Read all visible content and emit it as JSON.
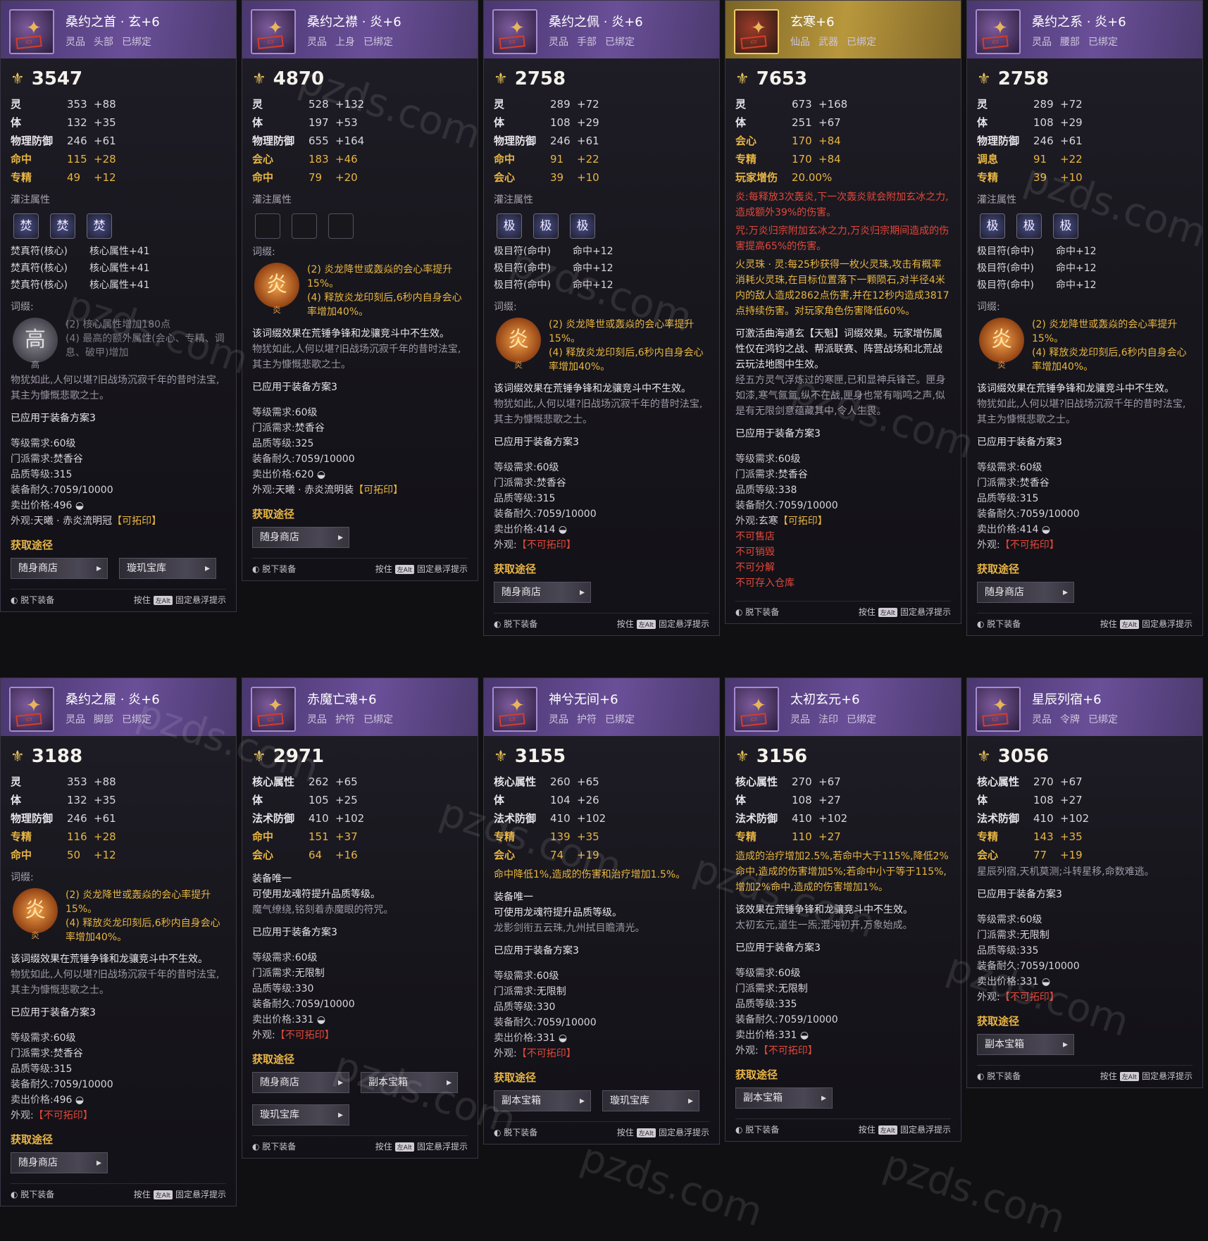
{
  "watermark": "pzds.com",
  "labels": {
    "infuse": "灌注属性",
    "affix": "词缀:",
    "source": "获取途径",
    "unequip": "脱下装备",
    "hold": "按住",
    "key": "左Alt",
    "pin": "固定悬浮提示",
    "levelReq": "等级需求:",
    "sectReq": "门派需求:",
    "quality": "品质等级:",
    "durability": "装备耐久:",
    "price": "卖出价格:",
    "look": "外观:"
  },
  "cards": [
    {
      "name": "桑约之首 · 玄+6",
      "tags": [
        "灵品",
        "头部",
        "已绑定"
      ],
      "power": "3547",
      "stats": [
        {
          "k": "灵",
          "v": "353",
          "b": "+88"
        },
        {
          "k": "体",
          "v": "132",
          "b": "+35"
        },
        {
          "k": "物理防御",
          "v": "246",
          "b": "+61"
        },
        {
          "k": "命中",
          "v": "115",
          "b": "+28",
          "hl": true
        },
        {
          "k": "专精",
          "v": "49",
          "b": "+12",
          "hl": true
        }
      ],
      "gems": [
        "焚",
        "焚",
        "焚"
      ],
      "gemlines": [
        [
          "焚真符(核心)",
          "核心属性+41"
        ],
        [
          "焚真符(核心)",
          "核心属性+41"
        ],
        [
          "焚真符(核心)",
          "核心属性+41"
        ]
      ],
      "badge": "高",
      "badgeGray": true,
      "effects": [
        "(2) 核心属性增加180点",
        "(4) 最高的额外属性(会心、专精、调息、破甲)增加"
      ],
      "effDim": true,
      "noteWhite": "",
      "flavor": "物犹如此,人何以堪?旧战场沉寂千年的昔时法宝,其主为慷慨悲歌之士。",
      "applied": "已应用于装备方案3",
      "level": "60级",
      "sect": "焚香谷",
      "quality": "315",
      "dur": "7059/10000",
      "price": "496",
      "lookA": "天曦 · 赤炎流明冠",
      "lookB": "【可拓印】",
      "lookRed": false,
      "sources": [
        "随身商店",
        "璇玑宝库"
      ]
    },
    {
      "name": "桑约之襟 · 炎+6",
      "tags": [
        "灵品",
        "上身",
        "已绑定"
      ],
      "power": "4870",
      "stats": [
        {
          "k": "灵",
          "v": "528",
          "b": "+132"
        },
        {
          "k": "体",
          "v": "197",
          "b": "+53"
        },
        {
          "k": "物理防御",
          "v": "655",
          "b": "+164"
        },
        {
          "k": "会心",
          "v": "183",
          "b": "+46",
          "hl": true
        },
        {
          "k": "命中",
          "v": "79",
          "b": "+20",
          "hl": true
        }
      ],
      "gems": [
        "",
        "",
        ""
      ],
      "gemlines": [],
      "badge": "炎",
      "badgeGray": false,
      "effects": [
        "(2) 炎龙降世或轰焱的会心率提升15%。",
        "(4) 释放炎龙印刻后,6秒内自身会心率增加40%。"
      ],
      "effDim": false,
      "noteWhite": "该词缀效果在荒锤争锋和龙骧竞斗中不生效。",
      "flavor": "物犹如此,人何以堪?旧战场沉寂千年的昔时法宝,其主为慷慨悲歌之士。",
      "applied": "已应用于装备方案3",
      "level": "60级",
      "sect": "焚香谷",
      "quality": "325",
      "dur": "7059/10000",
      "price": "620",
      "lookA": "天曦 · 赤炎流明装",
      "lookB": "【可拓印】",
      "lookRed": false,
      "sources": [
        "随身商店"
      ]
    },
    {
      "name": "桑约之佩 · 炎+6",
      "tags": [
        "灵品",
        "手部",
        "已绑定"
      ],
      "power": "2758",
      "stats": [
        {
          "k": "灵",
          "v": "289",
          "b": "+72"
        },
        {
          "k": "体",
          "v": "108",
          "b": "+29"
        },
        {
          "k": "物理防御",
          "v": "246",
          "b": "+61"
        },
        {
          "k": "命中",
          "v": "91",
          "b": "+22",
          "hl": true
        },
        {
          "k": "会心",
          "v": "39",
          "b": "+10",
          "hl": true
        }
      ],
      "gems": [
        "极",
        "极",
        "极"
      ],
      "gemlines": [
        [
          "极目符(命中)",
          "命中+12"
        ],
        [
          "极目符(命中)",
          "命中+12"
        ],
        [
          "极目符(命中)",
          "命中+12"
        ]
      ],
      "badge": "炎",
      "badgeGray": false,
      "effects": [
        "(2) 炎龙降世或轰焱的会心率提升15%。",
        "(4) 释放炎龙印刻后,6秒内自身会心率增加40%。"
      ],
      "effDim": false,
      "noteWhite": "该词缀效果在荒锤争锋和龙骧竞斗中不生效。",
      "flavor": "物犹如此,人何以堪?旧战场沉寂千年的昔时法宝,其主为慷慨悲歌之士。",
      "applied": "已应用于装备方案3",
      "level": "60级",
      "sect": "焚香谷",
      "quality": "315",
      "dur": "7059/10000",
      "price": "414",
      "lookA": "",
      "lookB": "【不可拓印】",
      "lookRed": true,
      "sources": [
        "随身商店"
      ]
    },
    {
      "name": "玄寒+6",
      "tags": [
        "仙品",
        "武器",
        "已绑定"
      ],
      "power": "7653",
      "gold": true,
      "stats": [
        {
          "k": "灵",
          "v": "673",
          "b": "+168"
        },
        {
          "k": "体",
          "v": "251",
          "b": "+67"
        },
        {
          "k": "会心",
          "v": "170",
          "b": "+84",
          "hl": true
        },
        {
          "k": "专精",
          "v": "170",
          "b": "+84",
          "hl": true
        },
        {
          "k": "玩家增伤",
          "v": "20.00%",
          "b": "",
          "hl": true
        }
      ],
      "special": [
        "炎:每释放3次轰炎,下一次轰炎就会附加玄冰之力,造成额外39%的伤害。",
        "咒:万炎归宗附加玄冰之力,万炎归宗期间造成的伤害提高65%的伤害。",
        "火灵珠 · 灵:每25秒获得一枚火灵珠,攻击有概率消耗火灵珠,在目标位置落下一颗陨石,对半径4米内的敌人造成2862点伤害,并在12秒内造成3817点持续伤害。对玩家角色伤害降低60%。"
      ],
      "noteWhite": "可激活曲海通玄【天魁】词缀效果。玩家增伤属性仅在鸿钧之战、帮派联赛、阵营战场和北荒战云玩法地图中生效。",
      "flavor": "经五方灵气浮炼过的寒匣,已和显神兵锋芒。匣身如漆,寒气氤氲,纵不在战,匣身也常有嗡鸣之声,似是有无限剑意蕴藏其中,令人生畏。",
      "applied": "已应用于装备方案3",
      "level": "60级",
      "sect": "焚香谷",
      "quality": "338",
      "dur": "7059/10000",
      "price": "",
      "lookA": "玄寒",
      "lookB": "【可拓印】",
      "lookRed": false,
      "restrict": [
        "不可售店",
        "不可销毁",
        "不可分解",
        "不可存入仓库"
      ],
      "sources": []
    },
    {
      "name": "桑约之系 · 炎+6",
      "tags": [
        "灵品",
        "腰部",
        "已绑定"
      ],
      "power": "2758",
      "stats": [
        {
          "k": "灵",
          "v": "289",
          "b": "+72"
        },
        {
          "k": "体",
          "v": "108",
          "b": "+29"
        },
        {
          "k": "物理防御",
          "v": "246",
          "b": "+61"
        },
        {
          "k": "调息",
          "v": "91",
          "b": "+22",
          "hl": true
        },
        {
          "k": "专精",
          "v": "39",
          "b": "+10",
          "hl": true
        }
      ],
      "gems": [
        "极",
        "极",
        "极"
      ],
      "gemlines": [
        [
          "极目符(命中)",
          "命中+12"
        ],
        [
          "极目符(命中)",
          "命中+12"
        ],
        [
          "极目符(命中)",
          "命中+12"
        ]
      ],
      "badge": "炎",
      "badgeGray": false,
      "effects": [
        "(2) 炎龙降世或轰焱的会心率提升15%。",
        "(4) 释放炎龙印刻后,6秒内自身会心率增加40%。"
      ],
      "effDim": false,
      "noteWhite": "该词缀效果在荒锤争锋和龙骧竞斗中不生效。",
      "flavor": "物犹如此,人何以堪?旧战场沉寂千年的昔时法宝,其主为慷慨悲歌之士。",
      "applied": "已应用于装备方案3",
      "level": "60级",
      "sect": "焚香谷",
      "quality": "315",
      "dur": "7059/10000",
      "price": "414",
      "lookA": "",
      "lookB": "【不可拓印】",
      "lookRed": true,
      "sources": [
        "随身商店"
      ]
    },
    {
      "name": "桑约之履 · 炎+6",
      "tags": [
        "灵品",
        "脚部",
        "已绑定"
      ],
      "power": "3188",
      "stats": [
        {
          "k": "灵",
          "v": "353",
          "b": "+88"
        },
        {
          "k": "体",
          "v": "132",
          "b": "+35"
        },
        {
          "k": "物理防御",
          "v": "246",
          "b": "+61"
        },
        {
          "k": "专精",
          "v": "116",
          "b": "+28",
          "hl": true
        },
        {
          "k": "命中",
          "v": "50",
          "b": "+12",
          "hl": true
        }
      ],
      "gems": [],
      "gemlines": [],
      "badge": "炎",
      "badgeGray": false,
      "effects": [
        "(2) 炎龙降世或轰焱的会心率提升15%。",
        "(4) 释放炎龙印刻后,6秒内自身会心率增加40%。"
      ],
      "effDim": false,
      "noteWhite": "该词缀效果在荒锤争锋和龙骧竞斗中不生效。",
      "flavor": "物犹如此,人何以堪?旧战场沉寂千年的昔时法宝,其主为慷慨悲歌之士。",
      "applied": "已应用于装备方案3",
      "level": "60级",
      "sect": "焚香谷",
      "quality": "315",
      "dur": "7059/10000",
      "price": "496",
      "lookA": "",
      "lookB": "【不可拓印】",
      "lookRed": true,
      "sources": [
        "随身商店"
      ]
    },
    {
      "name": "赤魔亡魂+6",
      "tags": [
        "灵品",
        "护符",
        "已绑定"
      ],
      "power": "2971",
      "stats": [
        {
          "k": "核心属性",
          "v": "262",
          "b": "+65"
        },
        {
          "k": "体",
          "v": "105",
          "b": "+25"
        },
        {
          "k": "法术防御",
          "v": "410",
          "b": "+102"
        },
        {
          "k": "命中",
          "v": "151",
          "b": "+37",
          "hl": true
        },
        {
          "k": "会心",
          "v": "64",
          "b": "+16",
          "hl": true
        }
      ],
      "preNote": [
        "装备唯一",
        "可使用龙魂符提升品质等级。"
      ],
      "noteWhite": "",
      "flavor": "魔气缭绕,铭刻着赤魔眼的符咒。",
      "applied": "已应用于装备方案3",
      "level": "60级",
      "sect": "无限制",
      "quality": "330",
      "dur": "7059/10000",
      "price": "331",
      "lookA": "",
      "lookB": "【不可拓印】",
      "lookRed": true,
      "sources": [
        "随身商店",
        "副本宝箱",
        "璇玑宝库"
      ]
    },
    {
      "name": "神兮无间+6",
      "tags": [
        "灵品",
        "护符",
        "已绑定"
      ],
      "power": "3155",
      "stats": [
        {
          "k": "核心属性",
          "v": "260",
          "b": "+65"
        },
        {
          "k": "体",
          "v": "104",
          "b": "+26"
        },
        {
          "k": "法术防御",
          "v": "410",
          "b": "+102"
        },
        {
          "k": "专精",
          "v": "139",
          "b": "+35",
          "hl": true
        },
        {
          "k": "会心",
          "v": "74",
          "b": "+19",
          "hl": true
        }
      ],
      "special": [
        "命中降低1%,造成的伤害和治疗增加1.5%。"
      ],
      "preNote": [
        "装备唯一",
        "可使用龙魂符提升品质等级。"
      ],
      "noteWhite": "",
      "flavor": "龙影剑衔五云珠,九州拭目瞻清光。",
      "applied": "已应用于装备方案3",
      "level": "60级",
      "sect": "无限制",
      "quality": "330",
      "dur": "7059/10000",
      "price": "331",
      "lookA": "",
      "lookB": "【不可拓印】",
      "lookRed": true,
      "sources": [
        "副本宝箱",
        "璇玑宝库"
      ]
    },
    {
      "name": "太初玄元+6",
      "tags": [
        "灵品",
        "法印",
        "已绑定"
      ],
      "power": "3156",
      "stats": [
        {
          "k": "核心属性",
          "v": "270",
          "b": "+67"
        },
        {
          "k": "体",
          "v": "108",
          "b": "+27"
        },
        {
          "k": "法术防御",
          "v": "410",
          "b": "+102"
        },
        {
          "k": "专精",
          "v": "110",
          "b": "+27",
          "hl": true
        }
      ],
      "special": [
        "造成的治疗增加2.5%,若命中大于115%,降低2%命中,造成的伤害增加5%;若命中小于等于115%,增加2%命中,造成的伤害增加1%。"
      ],
      "noteWhite": "该效果在荒锤争锋和龙骧竞斗中不生效。",
      "flavor": "太初玄元,道生一炁;混沌初开,万象始成。",
      "applied": "已应用于装备方案3",
      "level": "60级",
      "sect": "无限制",
      "quality": "335",
      "dur": "7059/10000",
      "price": "331",
      "lookA": "",
      "lookB": "【不可拓印】",
      "lookRed": true,
      "sources": [
        "副本宝箱"
      ]
    },
    {
      "name": "星辰列宿+6",
      "tags": [
        "灵品",
        "令牌",
        "已绑定"
      ],
      "power": "3056",
      "stats": [
        {
          "k": "核心属性",
          "v": "270",
          "b": "+67"
        },
        {
          "k": "体",
          "v": "108",
          "b": "+27"
        },
        {
          "k": "法术防御",
          "v": "410",
          "b": "+102"
        },
        {
          "k": "专精",
          "v": "143",
          "b": "+35",
          "hl": true
        },
        {
          "k": "会心",
          "v": "77",
          "b": "+19",
          "hl": true
        }
      ],
      "noteWhite": "",
      "flavor": "星辰列宿,天机莫测;斗转星移,命数难逃。",
      "applied": "已应用于装备方案3",
      "level": "60级",
      "sect": "无限制",
      "quality": "335",
      "dur": "7059/10000",
      "price": "331",
      "lookA": "",
      "lookB": "【不可拓印】",
      "lookRed": true,
      "sources": [
        "副本宝箱"
      ]
    }
  ]
}
